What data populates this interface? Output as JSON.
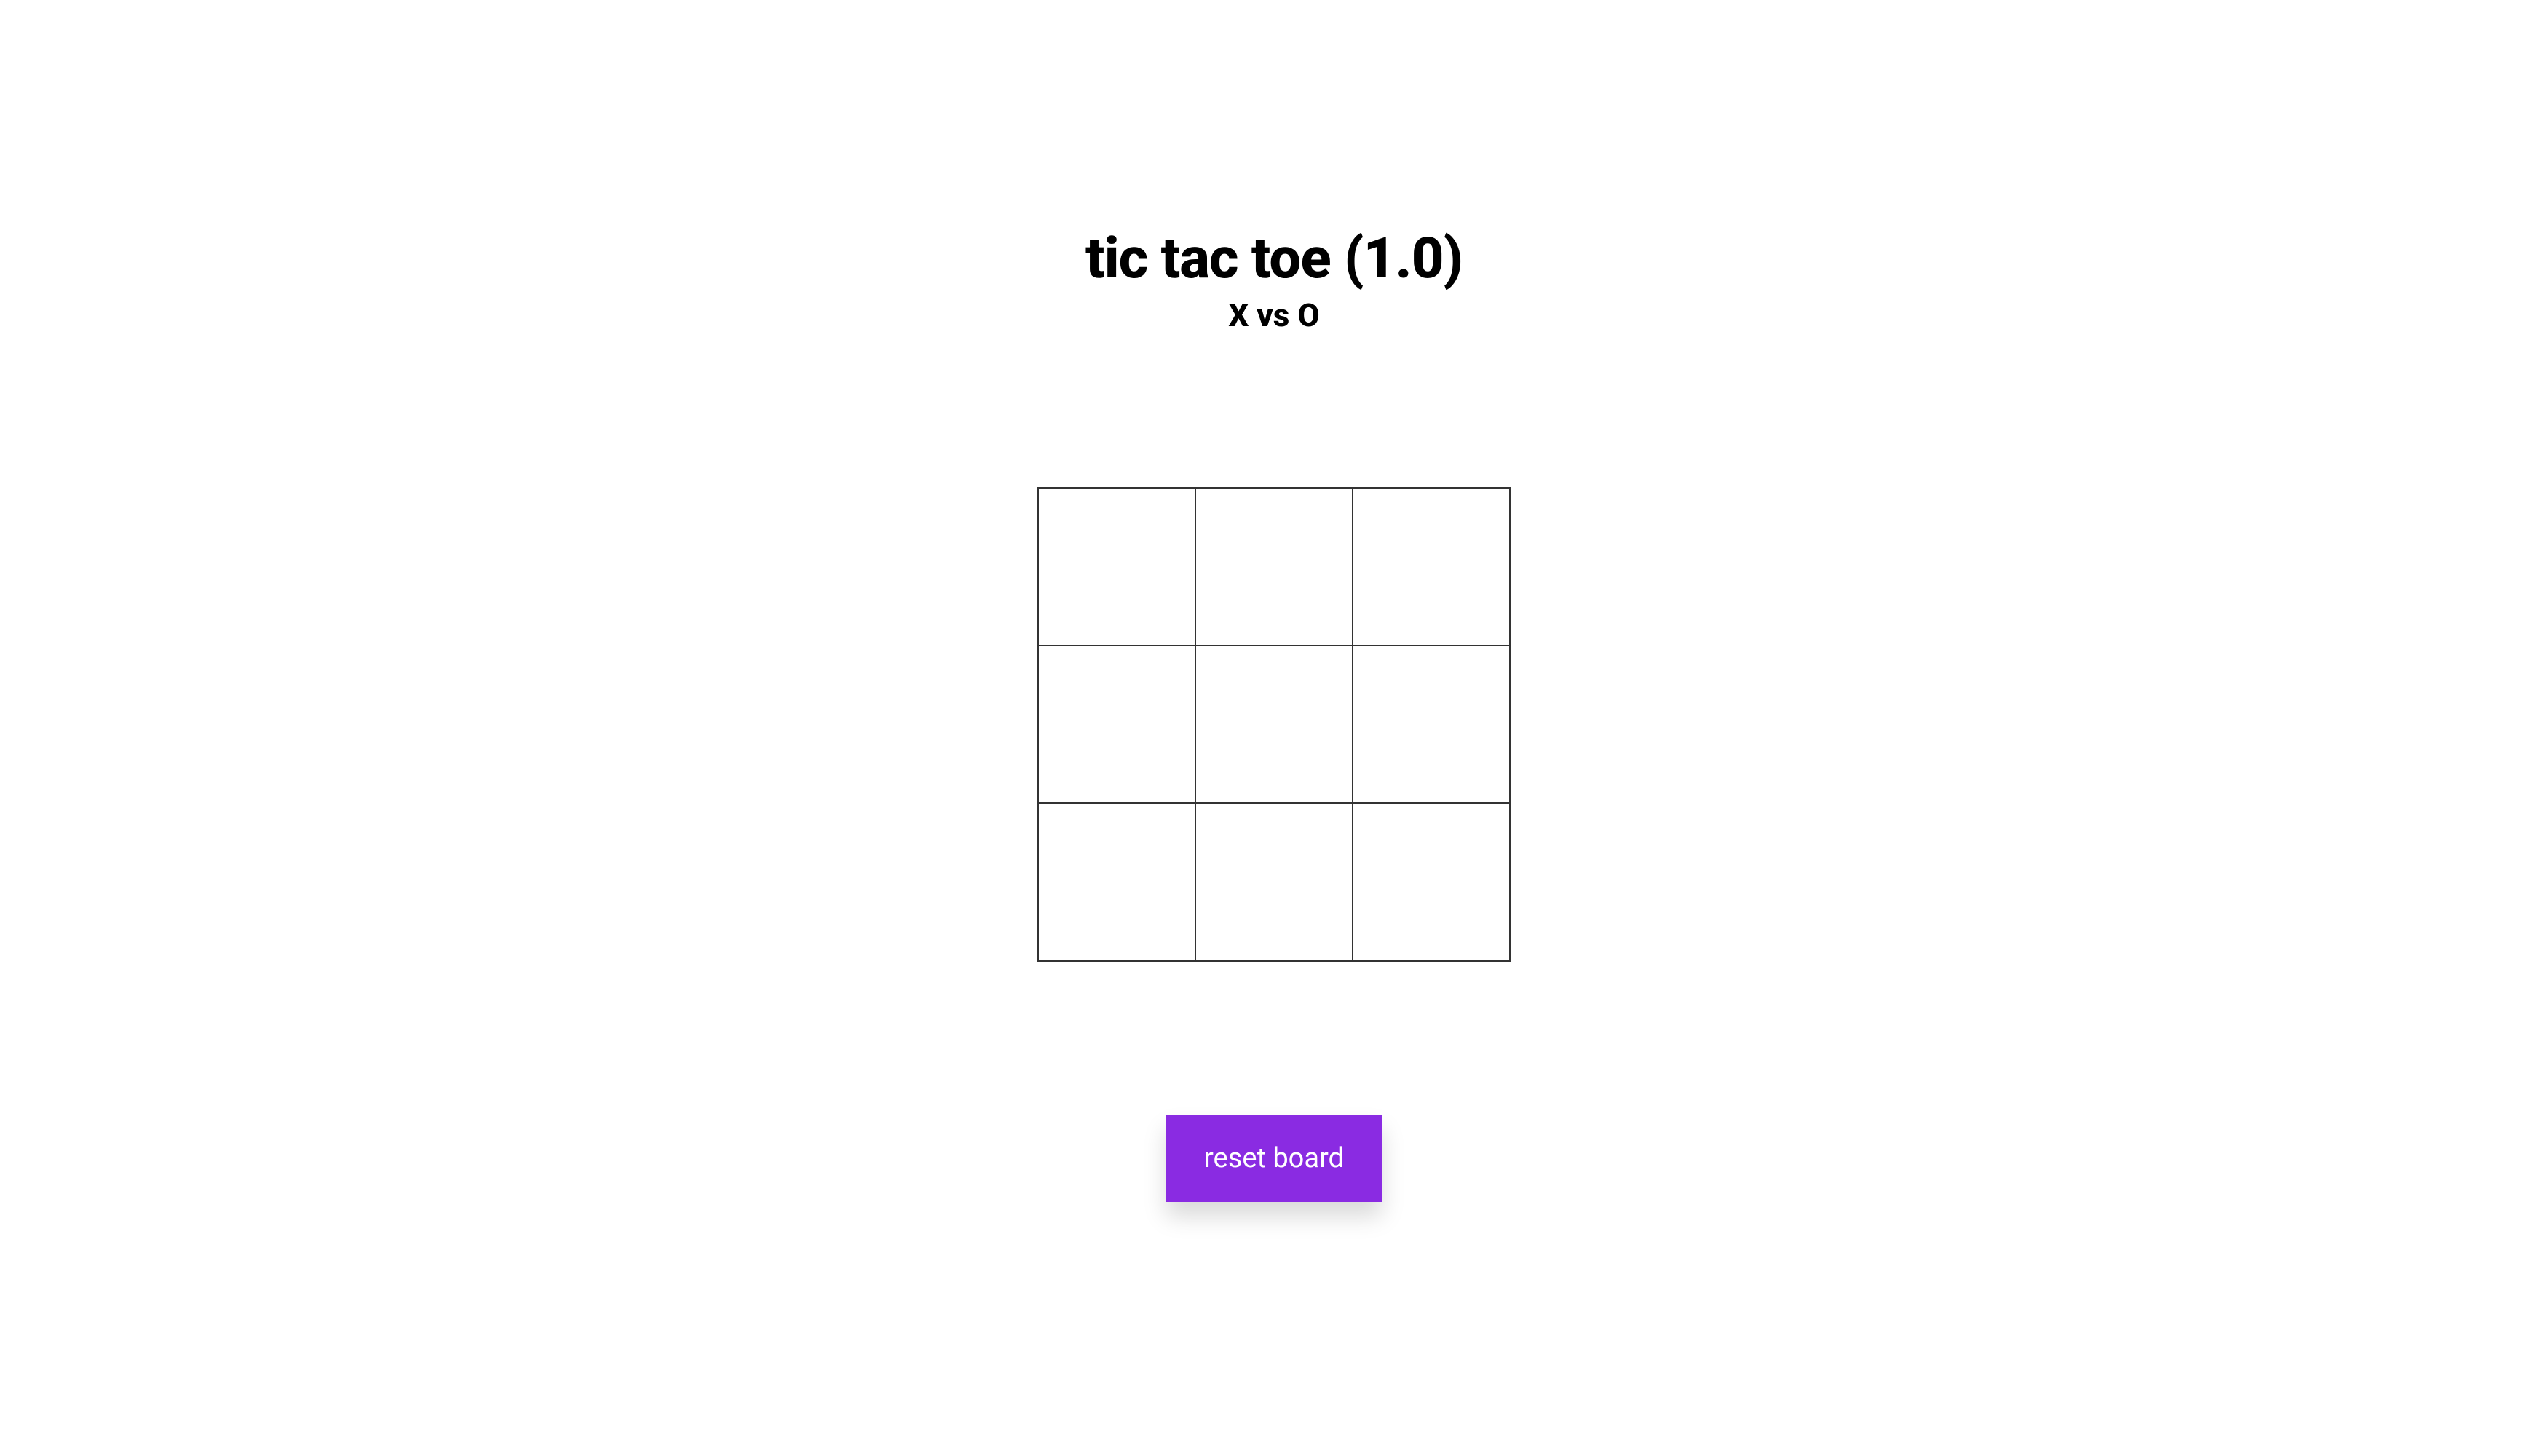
{
  "header": {
    "title": "tic tac toe (1.0)",
    "subtitle": "X vs O"
  },
  "board": {
    "cells": [
      "",
      "",
      "",
      "",
      "",
      "",
      "",
      "",
      ""
    ]
  },
  "controls": {
    "reset_label": "reset board"
  },
  "colors": {
    "accent": "#8a2be2",
    "border": "#333333",
    "background": "#ffffff"
  }
}
